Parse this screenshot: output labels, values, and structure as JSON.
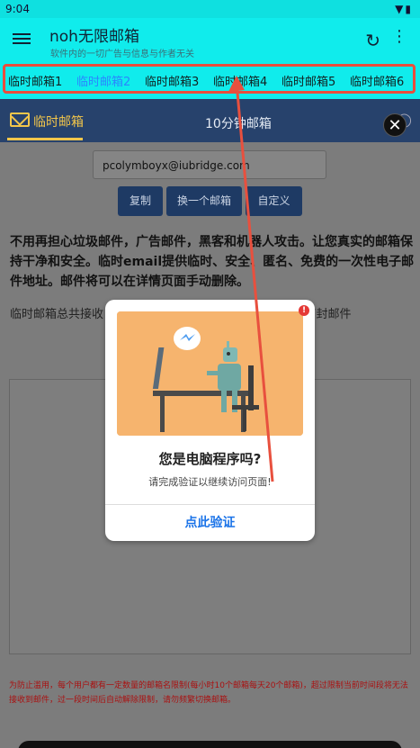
{
  "status_bar": {
    "time": "9:04",
    "icons": "wifi-icon battery-icon"
  },
  "app_bar": {
    "title": "noh无限邮箱",
    "subtitle": "软件内的一切广告与信息与作者无关"
  },
  "tabs": [
    {
      "label": "临时邮箱1",
      "active": false
    },
    {
      "label": "临时邮箱2",
      "active": true
    },
    {
      "label": "临时邮箱3",
      "active": false
    },
    {
      "label": "临时邮箱4",
      "active": false
    },
    {
      "label": "临时邮箱5",
      "active": false
    },
    {
      "label": "临时邮箱6",
      "active": false
    }
  ],
  "sub_tabs": {
    "temp_mail": "临时邮箱",
    "ten_min_mail": "10分钟邮箱"
  },
  "email": {
    "address": "pcolymboyx@iubridge.com"
  },
  "buttons": {
    "copy": "复制",
    "change": "换一个邮箱",
    "custom": "自定义"
  },
  "description": "不用再担心垃圾邮件，广告邮件，黑客和机器人攻击。让您真实的邮箱保持干净和安全。临时email提供临时、安全、匿名、免费的一次性电子邮件地址。邮件将可以在详情页面手动删除。",
  "stats": {
    "left": "临时邮箱总共接收",
    "right": "47封邮件"
  },
  "notice": "为防止滥用，每个用户都有一定数量的邮箱名限制(每小时10个邮箱每天20个邮箱)，超过限制当前时间段将无法接收到邮件，过一段时间后自动解除限制，请勿频繁切换邮箱。",
  "popup": {
    "heading": "您是电脑程序吗?",
    "subtext": "请完成验证以继续访问页面!",
    "verify_label": "点此验证",
    "alert_badge": "!"
  },
  "colors": {
    "accent": "#10ecec",
    "active_tab": "#2a86ff",
    "highlight": "#ea4d3c",
    "subbar": "#27426c",
    "gold": "#f3c64a"
  }
}
